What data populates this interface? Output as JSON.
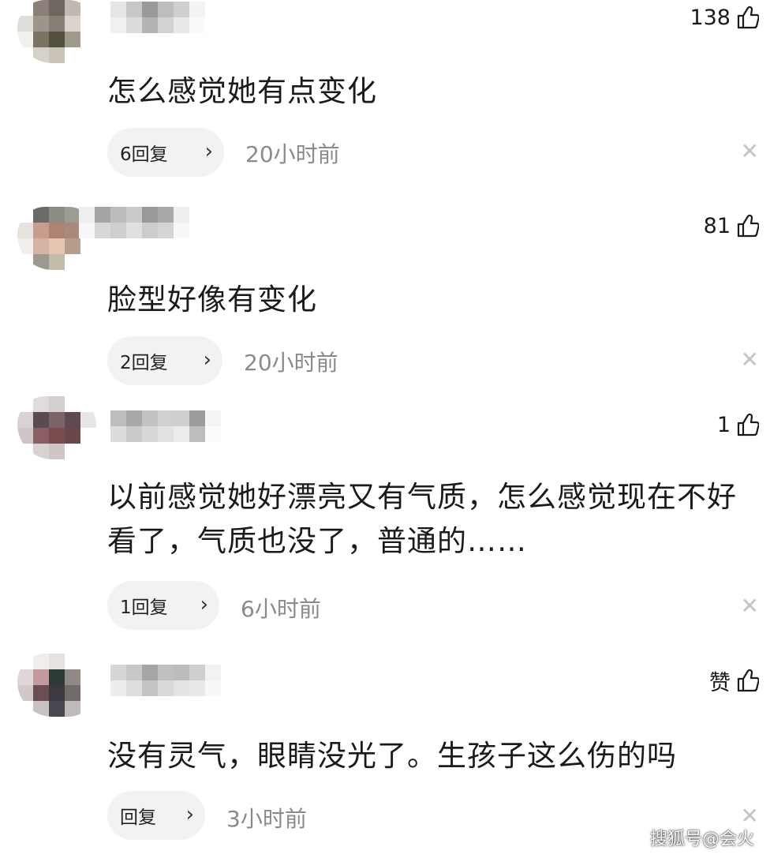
{
  "comments": [
    {
      "likes": "138",
      "text": "怎么感觉她有点变化",
      "reply_label": "6回复",
      "time": "20小时前",
      "avatar_colors": [
        "#ffffff",
        "#8a8079",
        "#6e665f",
        "#c0b9b2",
        "#ffffff",
        "#e0dcd8",
        "#9d958c",
        "#877f76",
        "#d8d3ce",
        "#ffffff",
        "#f2f0ed",
        "#7a7263",
        "#545040",
        "#a09a8a",
        "#ffffff",
        "#ffffff",
        "#d6d1c9",
        "#c9c3b8",
        "#ffffff",
        "#ffffff"
      ],
      "name_colors": [
        "#e6e6e6",
        "#f0f0f0",
        "#c8c8c8",
        "#dcdcdc",
        "#9a9a9a",
        "#b4b4b4",
        "#bdbdbd",
        "#d2d2d2",
        "#cfcfcf",
        "#e8e8e8",
        "#f3f3f3",
        "#fafafa"
      ]
    },
    {
      "likes": "81",
      "text": "脸型好像有变化",
      "reply_label": "2回复",
      "time": "20小时前",
      "avatar_colors": [
        "#ffffff",
        "#6a6a66",
        "#8b8c84",
        "#9e9b94",
        "#ffffff",
        "#e6e2de",
        "#c89d8e",
        "#b08274",
        "#a8897c",
        "#ffffff",
        "#f2eeeb",
        "#d6b3a3",
        "#e5c4b2",
        "#b69e8a",
        "#ffffff",
        "#ffffff",
        "#9c9a8e",
        "#c4bca8",
        "#ffffff",
        "#ffffff"
      ],
      "name_colors": [
        "#eeeeee",
        "#f6f6f6",
        "#a4a4a4",
        "#d8d8d8",
        "#bcbcbc",
        "#cfcfcf",
        "#cacaca",
        "#e0e0e0",
        "#999999",
        "#cccccc",
        "#a9a9a9",
        "#d4d4d4",
        "#efefef",
        "#f7f7f7"
      ]
    },
    {
      "likes": "1",
      "text": "以前感觉她好漂亮又有气质，怎么感觉现在不好看了，气质也没了，普通的……",
      "reply_label": "1回复",
      "time": "6小时前",
      "avatar_colors": [
        "#ffffff",
        "#e0dcdc",
        "#d4d0cf",
        "#ffffff",
        "#ffffff",
        "#d8d2d2",
        "#5a4a52",
        "#7a6468",
        "#5e4a52",
        "#e8e6e6",
        "#cfc7c7",
        "#8a5e62",
        "#7a4c50",
        "#6a484a",
        "#ffffff",
        "#ffffff",
        "#d8d2d2",
        "#cfc6c6",
        "#ffffff",
        "#ffffff"
      ],
      "name_colors": [
        "#bdbdbd",
        "#dcdcdc",
        "#a8a8a8",
        "#cacaca",
        "#c2c2c2",
        "#d8d8d8",
        "#d0d0d0",
        "#e2e2e2",
        "#cfcfcf",
        "#ececec",
        "#9c9c9c",
        "#bdbdbd",
        "#f5f5f5",
        "#fbfbfb"
      ]
    },
    {
      "likes": "赞",
      "text": "没有灵气，眼睛没光了。生孩子这么伤的吗",
      "reply_label": "回复",
      "time": "3小时前",
      "avatar_colors": [
        "#ffffff",
        "#f0eded",
        "#e6e2e0",
        "#ffffff",
        "#ffffff",
        "#e0d8d8",
        "#c59a9e",
        "#2e3a36",
        "#8f8a86",
        "#ffffff",
        "#d2c8c8",
        "#6c4e52",
        "#3c3a40",
        "#716c6a",
        "#ffffff",
        "#ffffff",
        "#c8c2c2",
        "#4a4650",
        "#bfbab8",
        "#ffffff"
      ],
      "name_colors": [
        "#d6d6d6",
        "#ededed",
        "#c8c8c8",
        "#dedede",
        "#a6a6a6",
        "#c4c4c4",
        "#c0c0c0",
        "#d9d9d9",
        "#bcbcbc",
        "#e4e4e4",
        "#cfcfcf",
        "#e9e9e9",
        "#f2f2f2",
        "#f8f8f8"
      ]
    }
  ],
  "watermark": "搜狐号@会火",
  "icons": {
    "like": "thumbs-up-icon",
    "chevron": "chevron-right-icon",
    "close": "close-icon"
  }
}
